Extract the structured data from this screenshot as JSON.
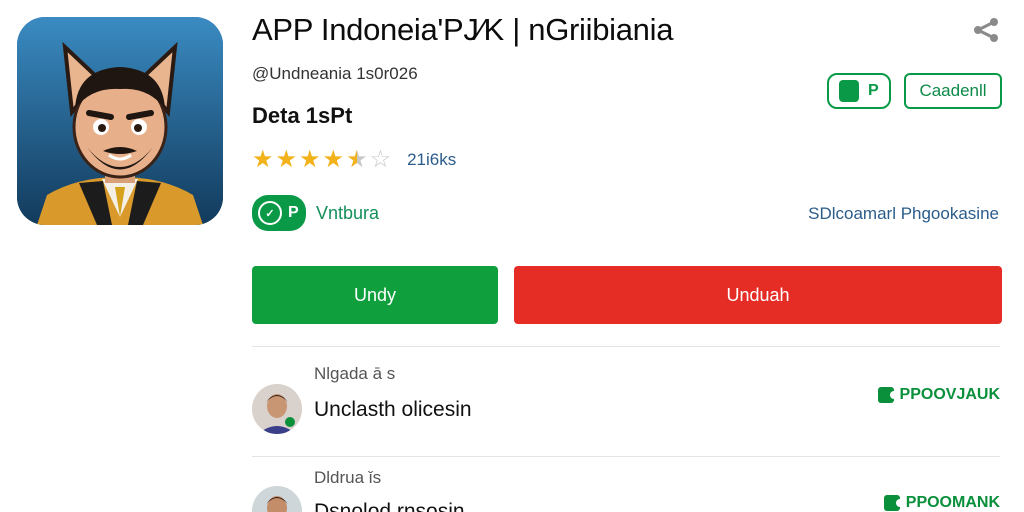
{
  "app": {
    "title": "APP Indoneia'PJ⁄K | nGriibiania",
    "handle": "@Undneania 1s0r026",
    "subtitle": "Deta 1sPt",
    "rating_stars": 4.5,
    "rating_count": "21i6ks",
    "badge_initial": "P",
    "badge_label": "Vntbura",
    "tag_initial": "P",
    "tag_button": "Caadenll",
    "developer": "SDlcoamarl Phgookasine"
  },
  "actions": {
    "primary_label": "Undy",
    "secondary_label": "Unduah"
  },
  "reviews": [
    {
      "name": "Nlgada ā s",
      "text": "Unclasth olicesin",
      "status": "PPOOVJAUK"
    },
    {
      "name": "Dldrua ǐs",
      "text": "Dsnolod rnsosin",
      "status": "PPOOMANK"
    }
  ],
  "colors": {
    "green": "#109f3d",
    "red": "#e52c25",
    "star": "#f2b21b",
    "link_blue": "#2b5c8a"
  },
  "icons": {
    "share": "share-icon",
    "badge": "verified-badge-icon",
    "status": "tag-icon"
  }
}
